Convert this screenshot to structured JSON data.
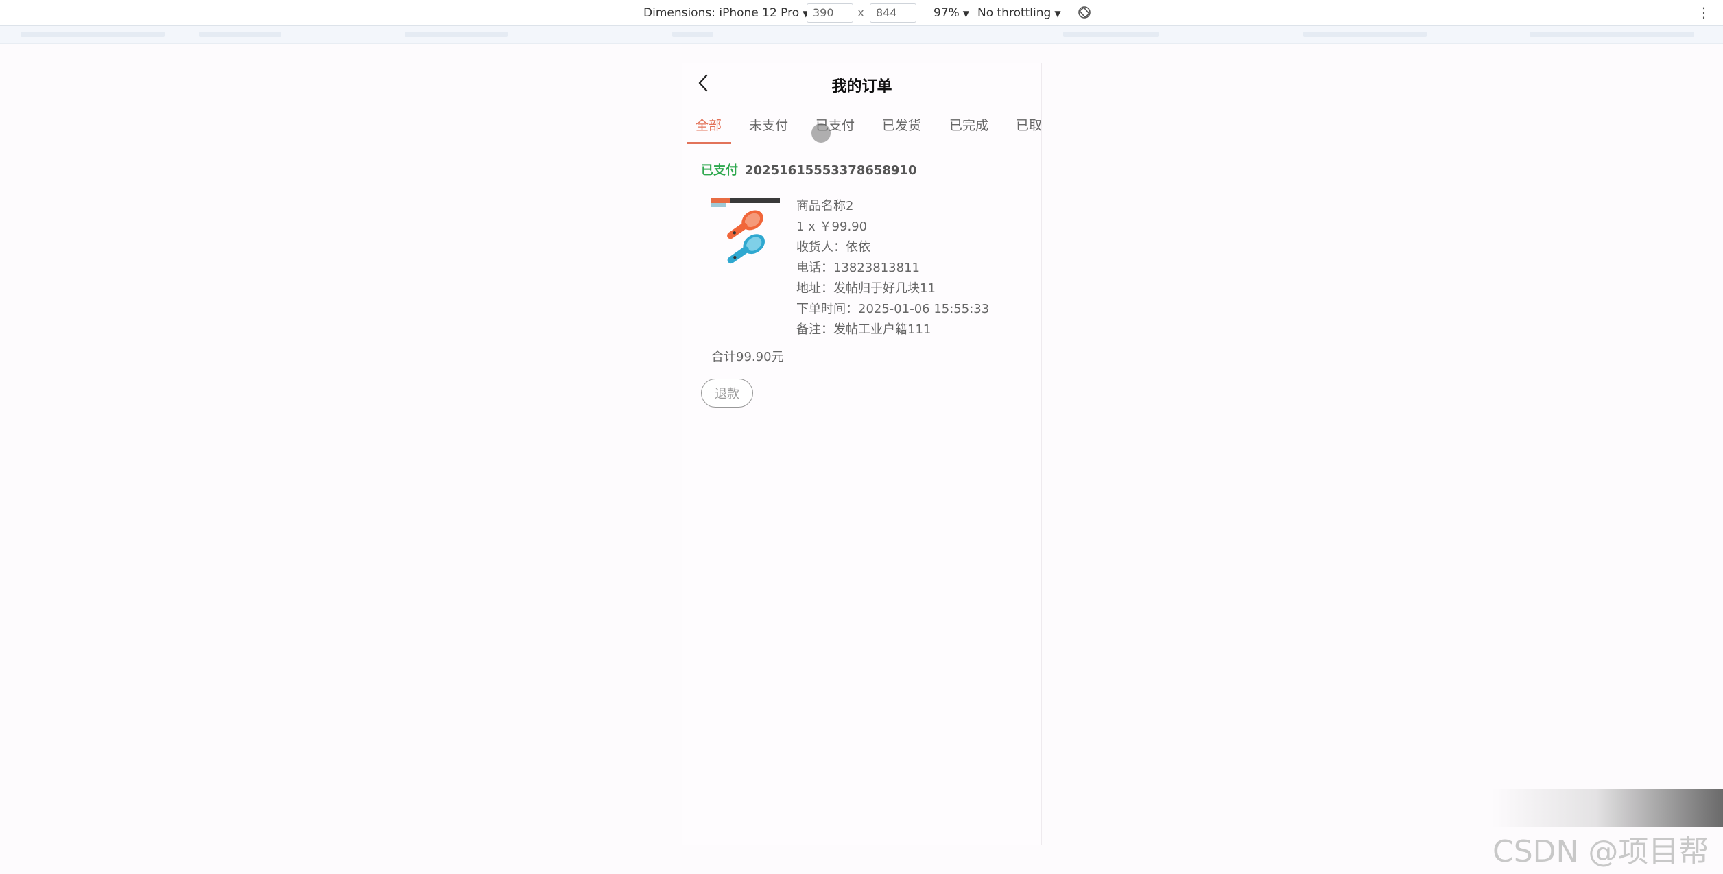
{
  "devtools": {
    "dimensions_label": "Dimensions: iPhone 12 Pro",
    "width_value": "390",
    "times": "x",
    "height_value": "844",
    "zoom": "97%",
    "throttling": "No throttling"
  },
  "page": {
    "title": "我的订单",
    "tabs": [
      "全部",
      "未支付",
      "已支付",
      "已发货",
      "已完成",
      "已取"
    ],
    "active_tab": 0
  },
  "order": {
    "status": "已支付",
    "order_no": "20251615553378658910",
    "product_name": "商品名称2",
    "qty_price": "1 x ￥99.90",
    "receiver": "收货人：依依",
    "phone": "电话：13823813811",
    "address": "地址：发帖归于好几块11",
    "order_time": "下单时间：2025-01-06 15:55:33",
    "note": "备注：发帖工业户籍111",
    "total": "合计99.90元",
    "refund_label": "退款"
  },
  "colors": {
    "accent": "#e2735a",
    "status_paid": "#2fa84f"
  },
  "watermark": "CSDN @项目帮"
}
